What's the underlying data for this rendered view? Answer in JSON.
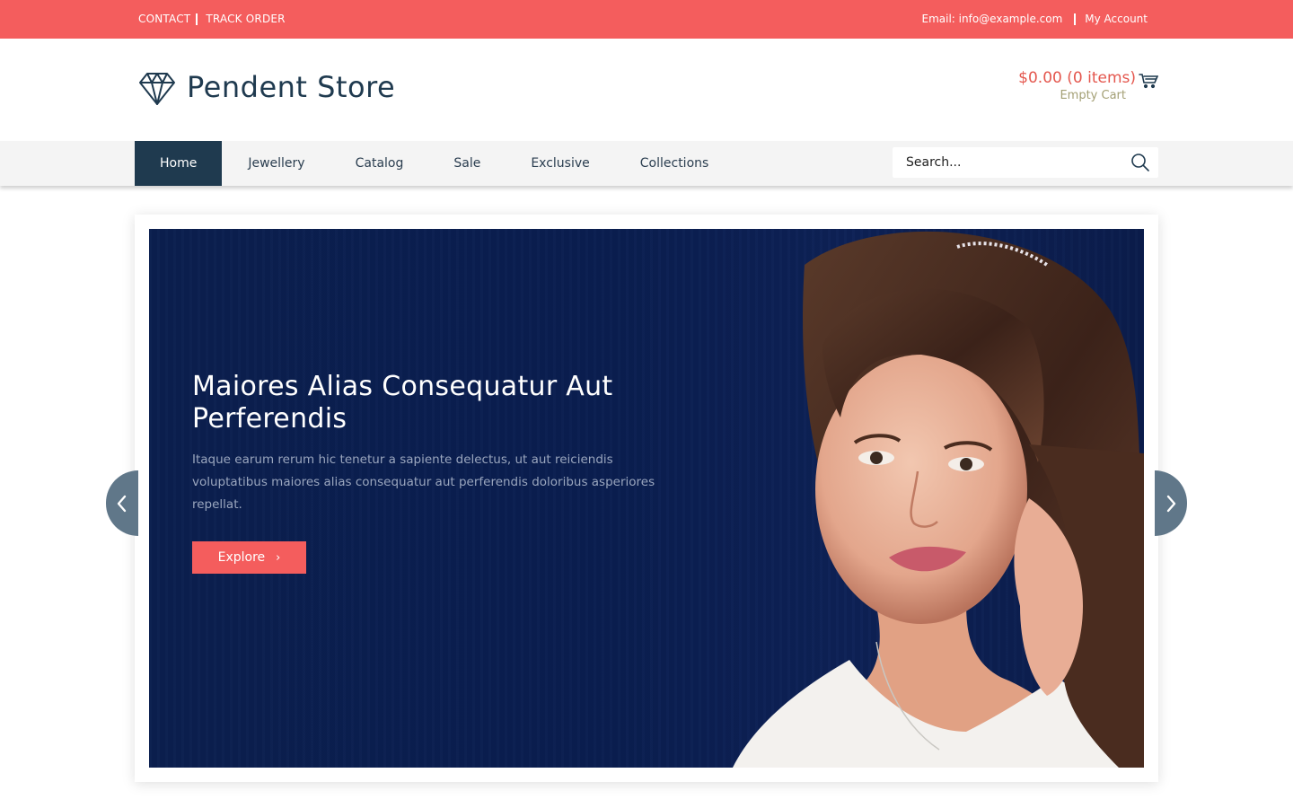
{
  "topbar": {
    "contact": "CONTACT",
    "track_order": "TRACK ORDER",
    "email": "Email: info@example.com",
    "account": "My Account"
  },
  "header": {
    "logo_icon": "diamond-icon",
    "store_name": "Pendent Store",
    "cart_total": "$0.00 (0 items)",
    "cart_status": "Empty Cart",
    "cart_icon": "shopping-cart-icon"
  },
  "nav": {
    "items": [
      {
        "label": "Home",
        "active": true
      },
      {
        "label": "Jewellery",
        "active": false
      },
      {
        "label": "Catalog",
        "active": false
      },
      {
        "label": "Sale",
        "active": false
      },
      {
        "label": "Exclusive",
        "active": false
      },
      {
        "label": "Collections",
        "active": false
      }
    ],
    "search_placeholder": "Search...",
    "search_icon": "search-icon"
  },
  "slider": {
    "title": "Maiores Alias Consequatur Aut Perferendis",
    "text": "Itaque earum rerum hic tenetur a sapiente delectus, ut aut reiciendis voluptatibus maiores alias consequatur aut perferendis doloribus asperiores repellat.",
    "button_label": "Explore",
    "prev_icon": "chevron-left-icon",
    "next_icon": "chevron-right-icon"
  },
  "colors": {
    "accent": "#f45d5d",
    "navy": "#1f3a4f",
    "slide_bg": "#0b1f4f",
    "arrow_bg": "#607789",
    "cart_status": "#a39f74"
  }
}
